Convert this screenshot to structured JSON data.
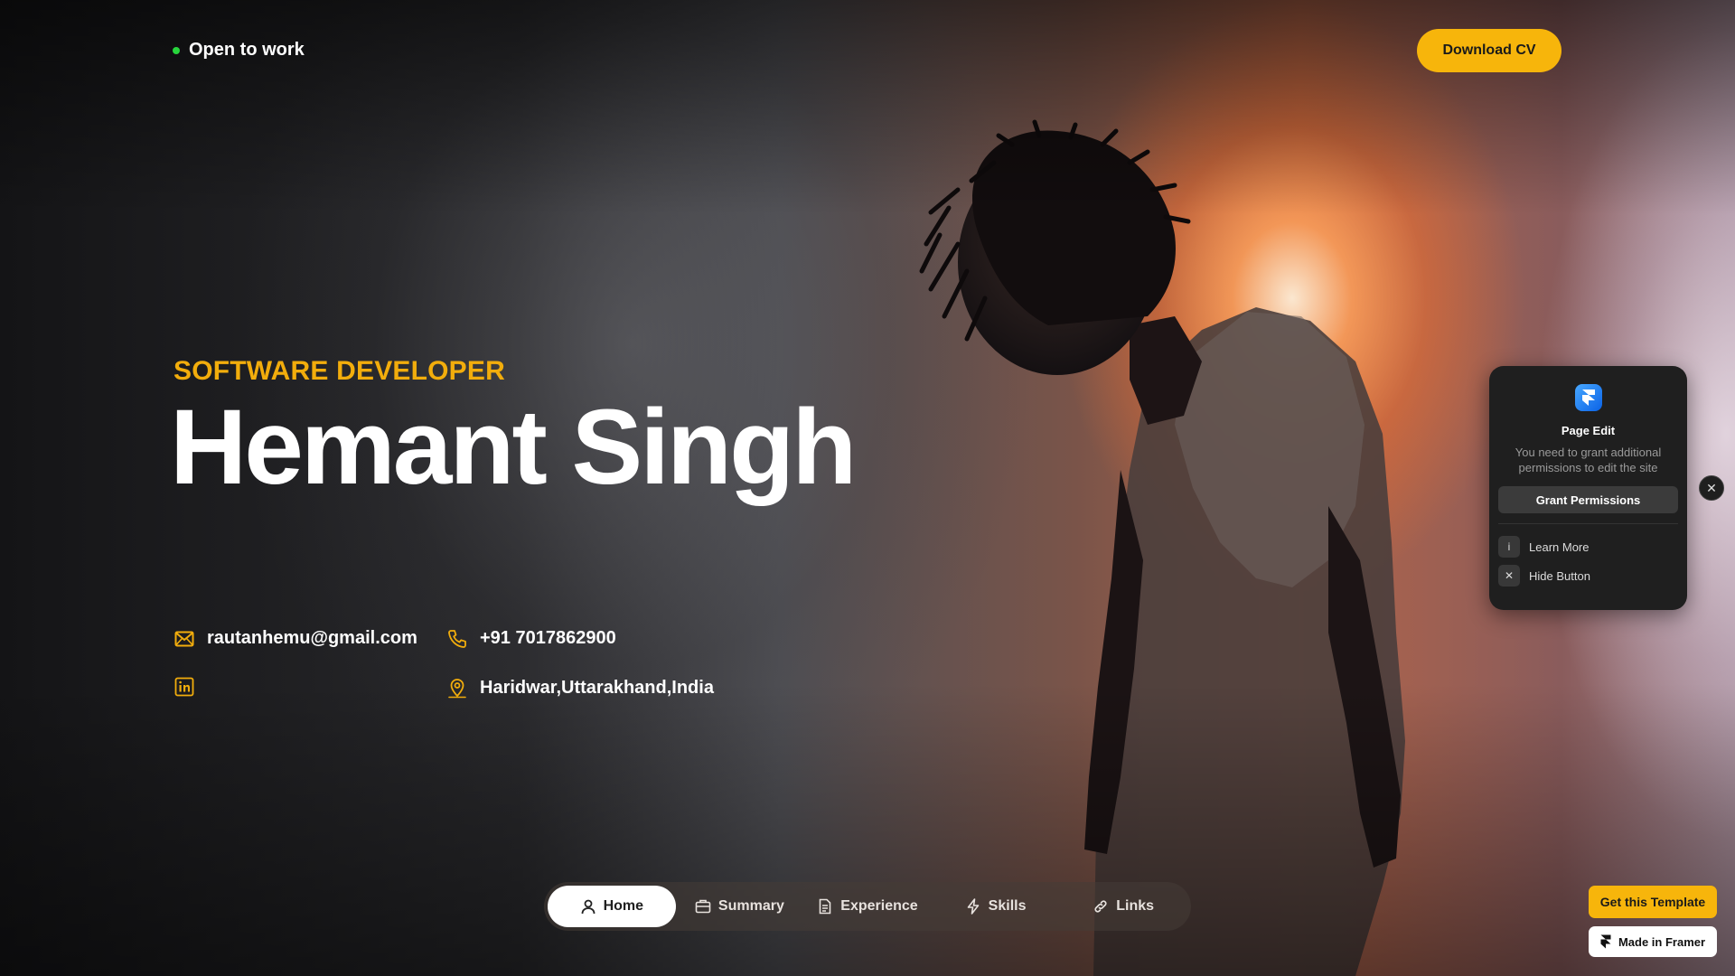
{
  "header": {
    "status_text": "Open to work",
    "status_color": "#27d53c",
    "download_label": "Download CV",
    "accent": "#f7b50b"
  },
  "hero": {
    "role": "SOFTWARE DEVELOPER",
    "name": "Hemant Singh"
  },
  "contacts": {
    "email": "rautanhemu@gmail.com",
    "phone": "+91 7017862900",
    "linkedin_icon": "linkedin-icon",
    "location": "Haridwar,Uttarakhand,India"
  },
  "nav": {
    "items": [
      {
        "label": "Home",
        "icon": "user-icon",
        "active": true
      },
      {
        "label": "Summary",
        "icon": "briefcase-icon",
        "active": false
      },
      {
        "label": "Experience",
        "icon": "document-icon",
        "active": false
      },
      {
        "label": "Skills",
        "icon": "lightning-icon",
        "active": false
      },
      {
        "label": "Links",
        "icon": "link-icon",
        "active": false
      }
    ]
  },
  "page_edit": {
    "title": "Page Edit",
    "description": "You need to grant additional permissions to edit the site",
    "grant_label": "Grant Permissions",
    "learn_more_label": "Learn More",
    "learn_more_icon": "i",
    "hide_label": "Hide Button",
    "hide_icon": "✕",
    "close_icon": "✕"
  },
  "promo": {
    "template_label": "Get this Template",
    "framer_label": "Made in Framer"
  }
}
